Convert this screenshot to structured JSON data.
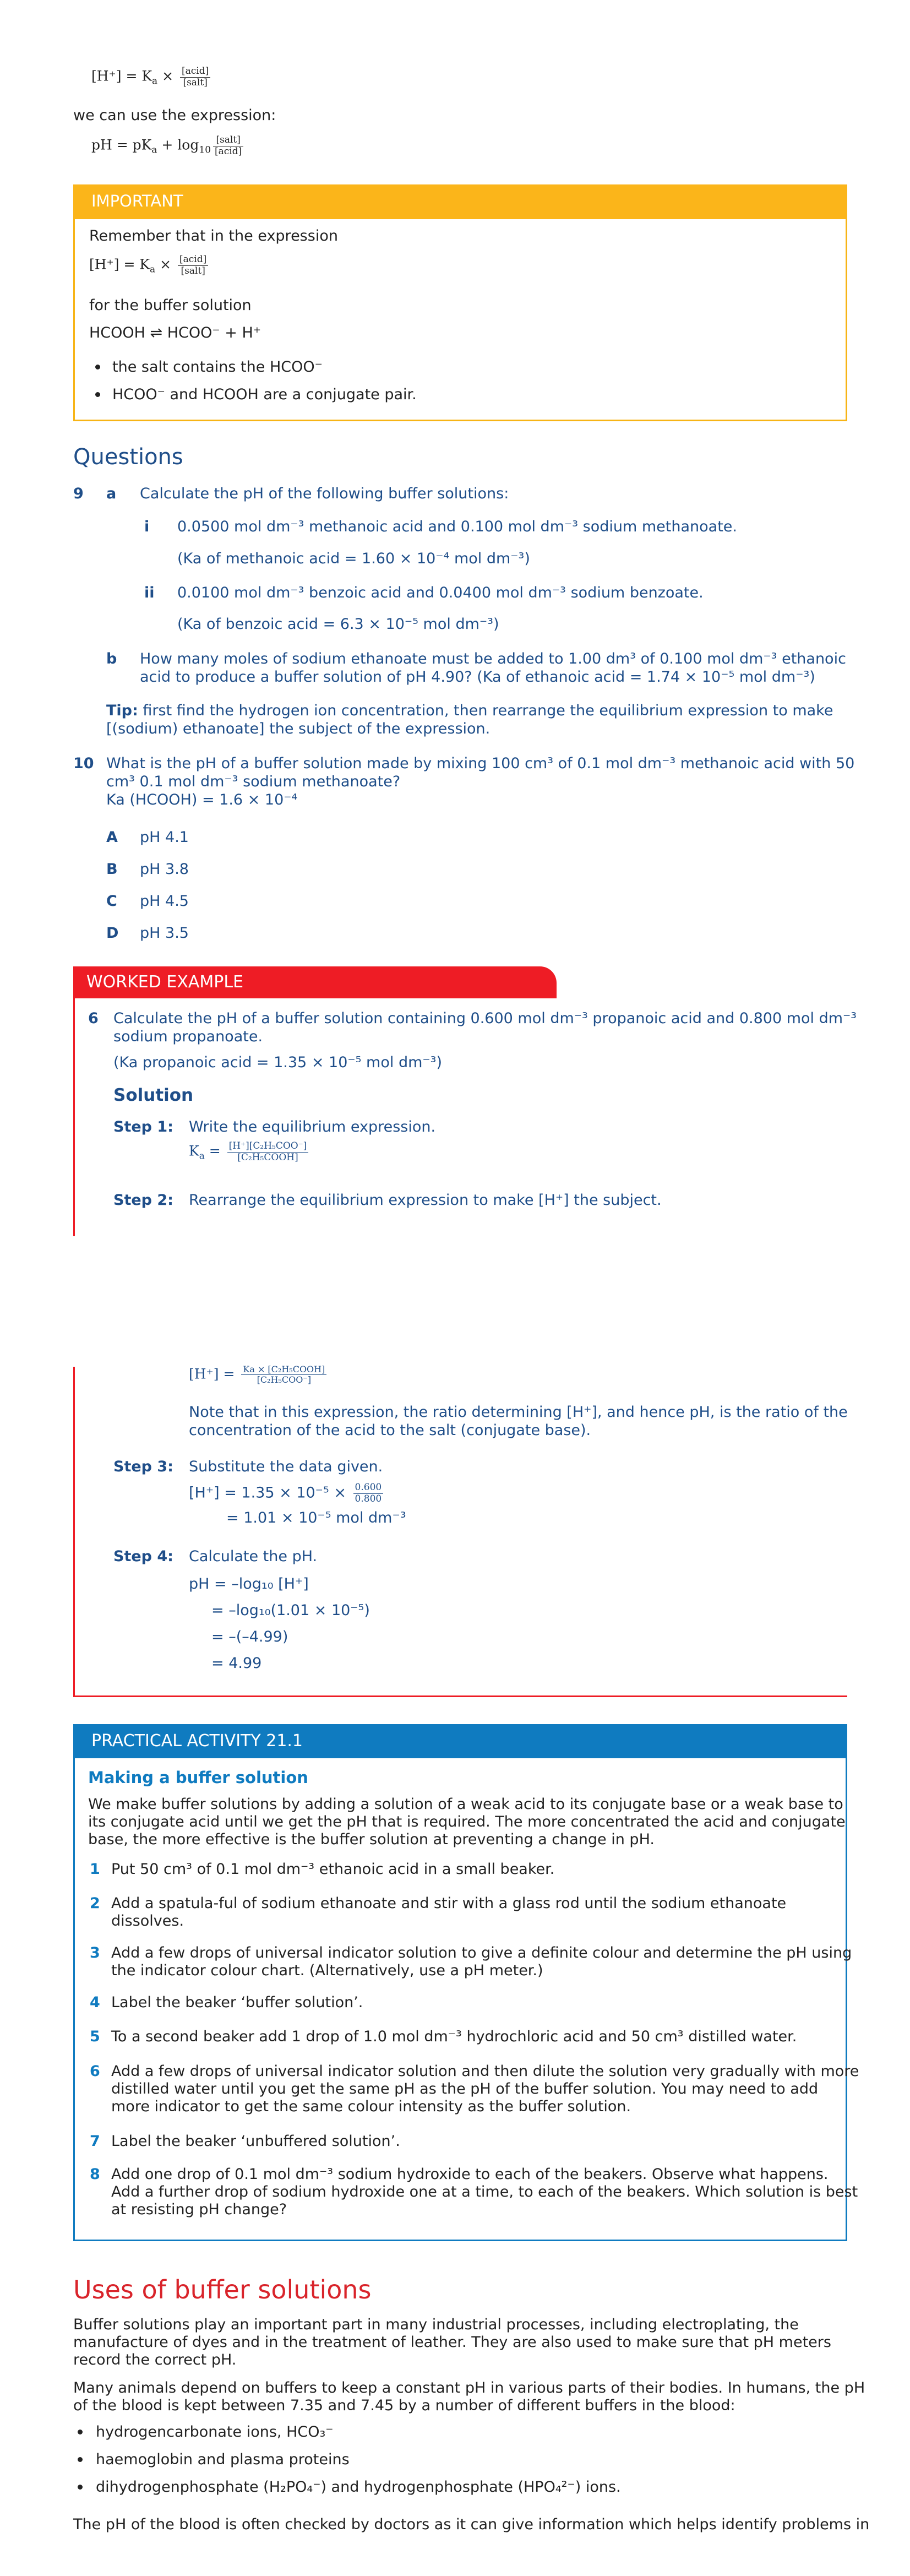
{
  "intro": {
    "formula1": {
      "lhs": "[H⁺] = K",
      "sub": "a",
      "times": " × ",
      "num": "[acid]",
      "den": "[salt]"
    },
    "use_expression": "we can use the expression:",
    "formula2": {
      "lhs": "pH = pK",
      "sub": "a",
      "plus": " + log",
      "log_sub": "10",
      "num": "[salt]",
      "den": "[acid]"
    }
  },
  "important": {
    "heading": "IMPORTANT",
    "remember": "Remember that in the expression",
    "formula": {
      "lhs": "[H⁺] = K",
      "sub": "a",
      "times": " × ",
      "num": "[acid]",
      "den": "[salt]"
    },
    "for_buffer": "for the buffer solution",
    "equilibrium": "HCOOH ⇌ HCOO⁻ + H⁺",
    "bullets": [
      "the salt contains the HCOO⁻",
      "HCOO⁻ and HCOOH are a conjugate pair."
    ]
  },
  "questions": {
    "heading": "Questions",
    "q9": {
      "number": "9",
      "a_label": "a",
      "a_text": "Calculate the pH of the following buffer solutions:",
      "i_label": "i",
      "i_text": "0.0500 mol dm⁻³ methanoic acid and 0.100 mol dm⁻³ sodium methanoate.",
      "i_ka": "(Ka of methanoic acid = 1.60 × 10⁻⁴ mol dm⁻³)",
      "ii_label": "ii",
      "ii_text": "0.0100 mol dm⁻³ benzoic acid and 0.0400 mol dm⁻³ sodium benzoate.",
      "ii_ka": "(Ka of benzoic acid = 6.3 × 10⁻⁵ mol dm⁻³)",
      "b_label": "b",
      "b_line1": "How many moles of sodium ethanoate must be added to 1.00 dm³ of 0.100 mol dm⁻³ ethanoic",
      "b_line2": "acid to produce a buffer solution of pH 4.90? (Ka of ethanoic acid = 1.74 × 10⁻⁵ mol dm⁻³)",
      "tip_label": "Tip:",
      "tip_line1": "first find the hydrogen ion concentration, then rearrange the equilibrium expression to make",
      "tip_line2": "[(sodium) ethanoate] the subject of the expression."
    },
    "q10": {
      "number": "10",
      "line1": "What is the pH of a buffer solution made by mixing 100 cm³ of 0.1 mol dm⁻³ methanoic acid with 50",
      "line2": "cm³ 0.1 mol dm⁻³ sodium methanoate?",
      "line3": "Ka (HCOOH) = 1.6 × 10⁻⁴",
      "options": [
        {
          "letter": "A",
          "text": "pH 4.1"
        },
        {
          "letter": "B",
          "text": "pH 3.8"
        },
        {
          "letter": "C",
          "text": "pH 4.5"
        },
        {
          "letter": "D",
          "text": "pH 3.5"
        }
      ]
    }
  },
  "worked_example": {
    "heading": "WORKED EXAMPLE",
    "number": "6",
    "line1": "Calculate the pH of a buffer solution containing 0.600 mol dm⁻³ propanoic acid and 0.800 mol dm⁻³",
    "line2": "sodium propanoate.",
    "ka": "(Ka propanoic acid = 1.35 × 10⁻⁵ mol dm⁻³)",
    "solution": "Solution",
    "step1_label": "Step 1:",
    "step1_text": "Write the equilibrium expression.",
    "step1_formula": {
      "lhs": "K",
      "sub": "a",
      "eq": " = ",
      "num": "[H⁺][C₂H₅COO⁻]",
      "den": "[C₂H₅COOH]"
    },
    "step2_label": "Step 2:",
    "step2_text": "Rearrange the equilibrium expression to make [H⁺] the subject.",
    "step2_formula": {
      "lhs": "[H⁺] = ",
      "num": "Ka × [C₂H₅COOH]",
      "den": "[C₂H₅COO⁻]"
    },
    "note_line1": "Note that in this expression, the ratio determining [H⁺], and hence pH, is the ratio of the",
    "note_line2": "concentration of the acid to the salt (conjugate base).",
    "step3_label": "Step 3:",
    "step3_text": "Substitute the data given.",
    "step3_line1": "[H⁺] = 1.35 × 10⁻⁵ ×",
    "step3_num": "0.600",
    "step3_den": "0.800",
    "step3_line2": "= 1.01 × 10⁻⁵ mol dm⁻³",
    "step4_label": "Step 4:",
    "step4_text": "Calculate the pH.",
    "step4_lines": [
      "pH = –log₁₀ [H⁺]",
      "= –log₁₀(1.01 × 10⁻⁵)",
      "= –(–4.99)",
      "= 4.99"
    ]
  },
  "practical": {
    "heading": "PRACTICAL ACTIVITY 21.1",
    "subheading": "Making a buffer solution",
    "intro": [
      "We make buffer solutions by adding a solution of a weak acid to its conjugate base or a weak base to",
      "its conjugate acid until we get the pH that is required. The more concentrated the acid and conjugate",
      "base, the more effective is the buffer solution at preventing a change in pH."
    ],
    "steps": [
      {
        "n": "1",
        "lines": [
          "Put 50 cm³ of 0.1 mol dm⁻³ ethanoic acid in a small beaker."
        ]
      },
      {
        "n": "2",
        "lines": [
          "Add a spatula-ful of sodium ethanoate and stir with a glass rod until the sodium ethanoate",
          "dissolves."
        ]
      },
      {
        "n": "3",
        "lines": [
          "Add a few drops of universal indicator solution to give a definite colour and determine the pH using",
          "the indicator colour chart. (Alternatively, use a pH meter.)"
        ]
      },
      {
        "n": "4",
        "lines": [
          "Label the beaker ‘buffer solution’."
        ]
      },
      {
        "n": "5",
        "lines": [
          "To a second beaker add 1 drop of 1.0 mol dm⁻³ hydrochloric acid and 50 cm³ distilled water."
        ]
      },
      {
        "n": "6",
        "lines": [
          "Add a few drops of universal indicator solution and then dilute the solution very gradually with more",
          "distilled water until you get the same pH as the pH of the buffer solution. You may need to add",
          "more indicator to get the same colour intensity as the buffer solution."
        ]
      },
      {
        "n": "7",
        "lines": [
          "Label the beaker ‘unbuffered solution’."
        ]
      },
      {
        "n": "8",
        "lines": [
          "Add one drop of 0.1 mol dm⁻³ sodium hydroxide to each of the beakers. Observe what happens.",
          "Add a further drop of sodium hydroxide one at a time, to each of the beakers. Which solution is best",
          "at resisting pH change?"
        ]
      }
    ]
  },
  "uses": {
    "heading": "Uses of buffer solutions",
    "para1": [
      "Buffer solutions play an important part in many industrial processes, including electroplating, the",
      "manufacture of dyes and in the treatment of leather. They are also used to make sure that pH meters",
      "record the correct pH."
    ],
    "para2": [
      "Many animals depend on buffers to keep a constant pH in various parts of their bodies. In humans, the pH",
      "of the blood is kept between 7.35 and 7.45 by a number of different buffers in the blood:"
    ],
    "bullets": [
      "hydrogencarbonate ions, HCO₃⁻",
      "haemoglobin and plasma proteins",
      "dihydrogenphosphate (H₂PO₄⁻) and hydrogenphosphate (HPO₄²⁻) ions."
    ],
    "para3": "The pH of the blood is often checked by doctors as it can give information which helps identify problems in"
  }
}
